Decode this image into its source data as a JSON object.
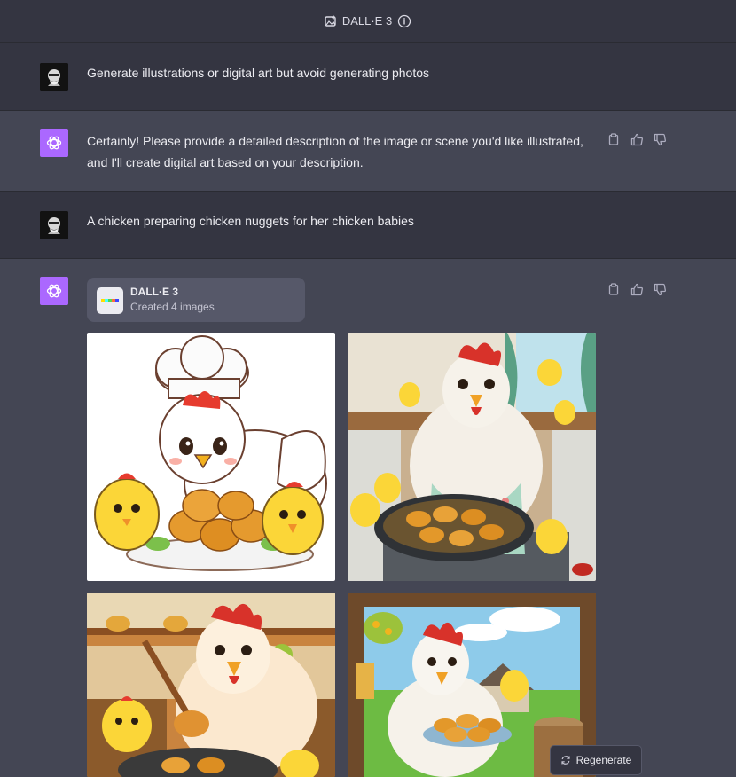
{
  "header": {
    "title": "DALL·E 3",
    "icon": "image-plus-icon",
    "info_icon": "info-icon"
  },
  "messages": [
    {
      "role": "user",
      "text": "Generate illustrations or digital art but avoid generating photos"
    },
    {
      "role": "assistant",
      "lines": [
        "Certainly! Please provide a detailed description of the image or scene you'd like illustrated,",
        "and I'll create digital art based on your description."
      ]
    },
    {
      "role": "user",
      "text": "A chicken preparing chicken nuggets for her chicken babies"
    },
    {
      "role": "assistant",
      "tool": {
        "name": "DALL·E 3",
        "status": "Created 4 images"
      }
    }
  ],
  "images": [
    {
      "name": "cartoon-hen-chef-white-background"
    },
    {
      "name": "hen-frying-nuggets-kitchen"
    },
    {
      "name": "hen-cooking-wooden-kitchen"
    },
    {
      "name": "hen-serving-nuggets-farm"
    }
  ],
  "actions": {
    "copy": "clipboard-icon",
    "like": "thumbs-up-icon",
    "dislike": "thumbs-down-icon"
  },
  "regenerate": {
    "label": "Regenerate",
    "icon": "refresh-icon"
  },
  "colors": {
    "background": "#343541",
    "assistant_row": "#444654",
    "accent": "#ab68ff"
  }
}
